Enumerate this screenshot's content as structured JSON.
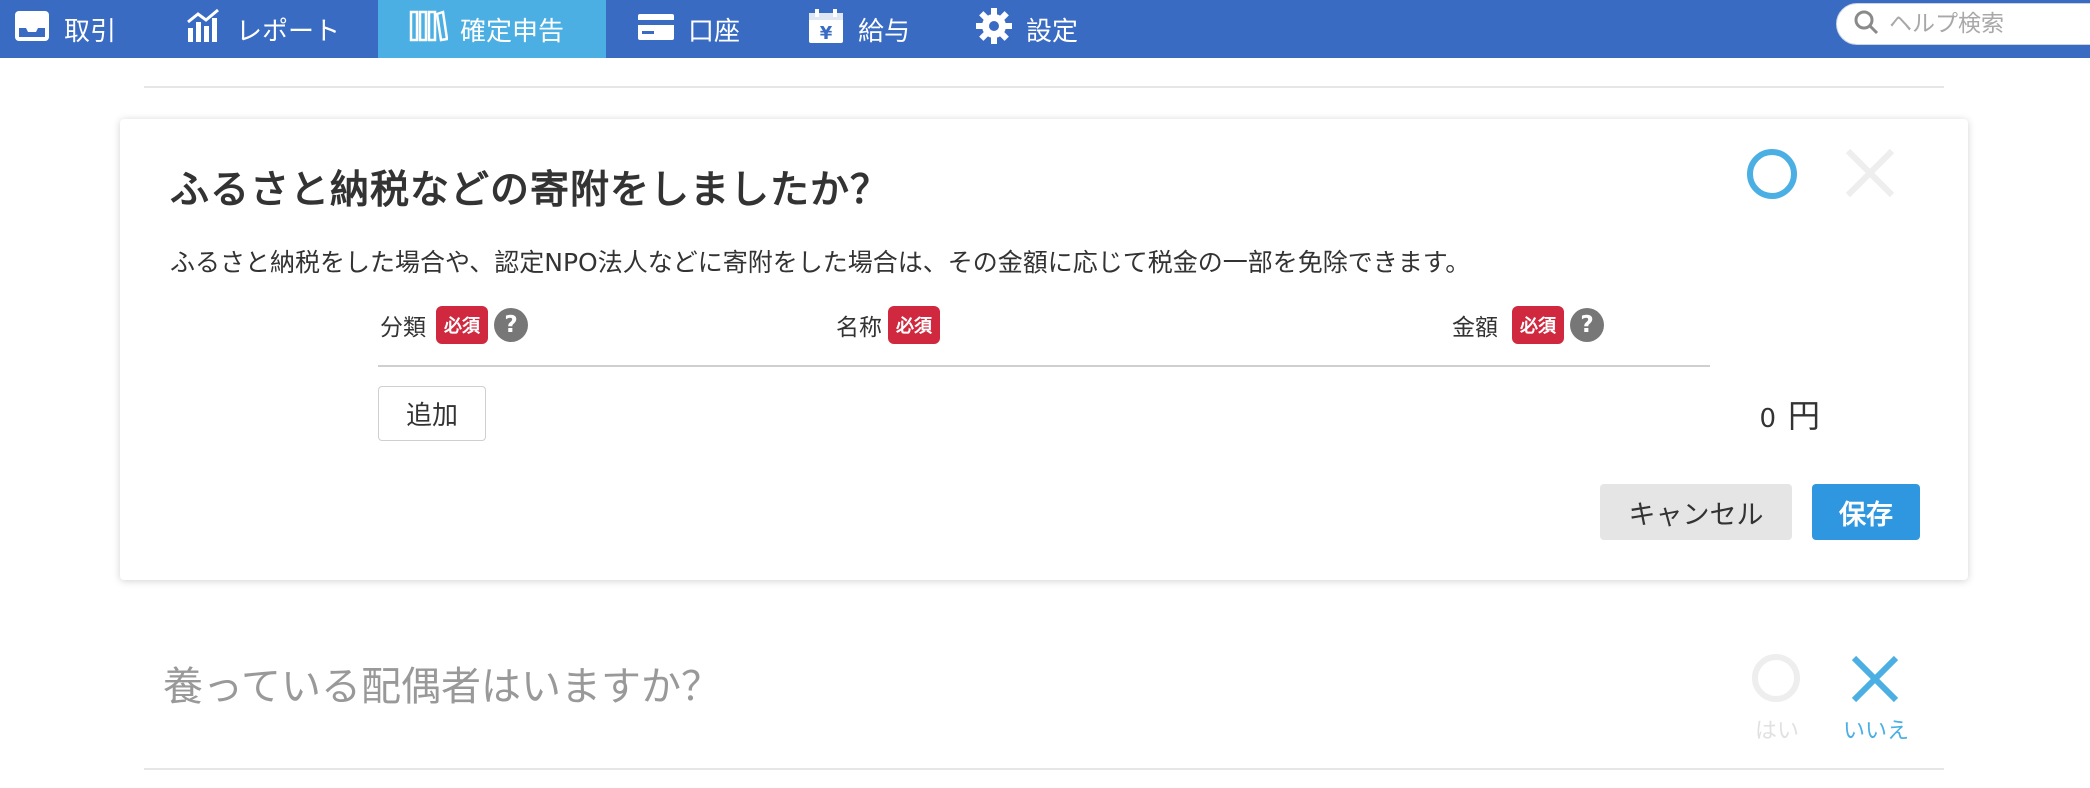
{
  "nav": {
    "items": [
      {
        "label": "取引",
        "icon": "inbox-icon"
      },
      {
        "label": "レポート",
        "icon": "chart-icon"
      },
      {
        "label": "確定申告",
        "icon": "books-icon",
        "active": true
      },
      {
        "label": "口座",
        "icon": "card-icon"
      },
      {
        "label": "給与",
        "icon": "calendar-yen-icon"
      },
      {
        "label": "設定",
        "icon": "gear-icon"
      }
    ],
    "search_placeholder": "ヘルプ検索"
  },
  "donation": {
    "title": "ふるさと納税などの寄附をしましたか？",
    "description": "ふるさと納税をした場合や、認定NPO法人などに寄附をした場合は、その金額に応じて税金の一部を免除できます。",
    "columns": {
      "category": "分類",
      "name": "名称",
      "amount": "金額",
      "required_badge": "必須",
      "help": "?"
    },
    "add_label": "追加",
    "total_value": "0",
    "total_unit": "円",
    "cancel_label": "キャンセル",
    "save_label": "保存",
    "answer_color": "#4bafe3"
  },
  "spouse": {
    "question": "養っている配偶者はいますか？",
    "yes_label": "はい",
    "no_label": "いいえ",
    "selected": "no"
  },
  "colors": {
    "nav_bg": "#3a6bc3",
    "nav_active": "#4bafe3",
    "required": "#d0283e",
    "primary_button": "#2e97e0"
  }
}
